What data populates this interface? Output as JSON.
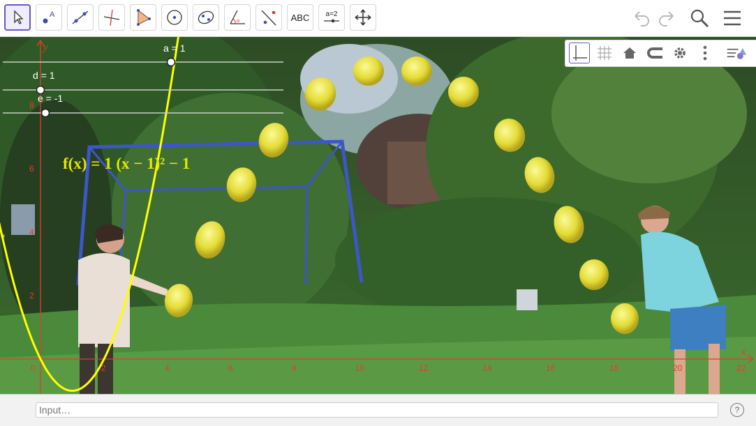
{
  "toolbar": {
    "tools": [
      {
        "name": "move-tool",
        "label": ""
      },
      {
        "name": "point-tool",
        "label": ""
      },
      {
        "name": "line-tool",
        "label": ""
      },
      {
        "name": "perpendicular-tool",
        "label": ""
      },
      {
        "name": "polygon-tool",
        "label": ""
      },
      {
        "name": "circle-tool",
        "label": ""
      },
      {
        "name": "ellipse-tool",
        "label": ""
      },
      {
        "name": "angle-tool",
        "label": ""
      },
      {
        "name": "reflect-tool",
        "label": ""
      },
      {
        "name": "text-tool",
        "label": "ABC"
      },
      {
        "name": "slider-tool",
        "label": "a=2"
      },
      {
        "name": "move-view-tool",
        "label": ""
      }
    ]
  },
  "sliders": {
    "a": "a = 1",
    "d": "d = 1",
    "e": "e = -1"
  },
  "function_label": "f(x) = 1 (x − 1)² − 1",
  "curve_name": "f",
  "axes": {
    "x_label": "x",
    "y_label": "y",
    "x_ticks": [
      "0",
      "2",
      "4",
      "6",
      "8",
      "10",
      "12",
      "14",
      "16",
      "18",
      "20",
      "22"
    ],
    "y_ticks": [
      "2",
      "4",
      "6",
      "8"
    ]
  },
  "input_bar": {
    "placeholder": "Input…",
    "help": "?"
  },
  "colors": {
    "accent": "#6557d2",
    "axis": "#e53c2a",
    "curve": "#ffff00",
    "label": "#e6e600"
  }
}
